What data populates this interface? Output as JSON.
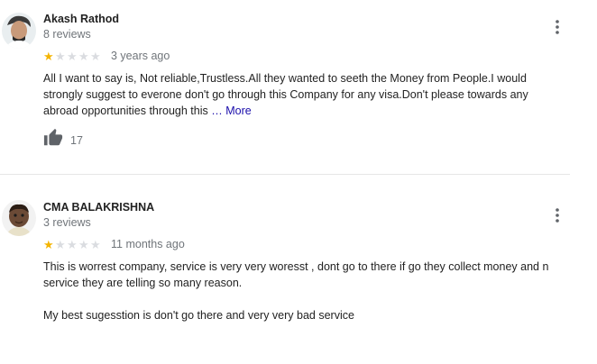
{
  "reviews": [
    {
      "author": "Akash Rathod",
      "review_count": "8 reviews",
      "rating": 1,
      "max_rating": 5,
      "date": "3 years ago",
      "lines": [
        "All I want to say is, Not reliable,Trustless.All they wanted to seeth the Money from People.I would",
        "strongly suggest to everone don't go through this Company for any visa.Don't please towards any",
        "abroad opportunities through this"
      ],
      "ellipsis": "…",
      "more_label": "More",
      "likes": "17",
      "like_icon": "thumbs-up-icon",
      "menu_icon": "more-vert-icon"
    },
    {
      "author": "CMA BALAKRISHNA",
      "review_count": "3 reviews",
      "rating": 1,
      "max_rating": 5,
      "date": "11 months ago",
      "lines": [
        "This is worrest company, service is very very woresst , dont go to there if go they collect money and n",
        "service they are telling so many reason.",
        "",
        "My best sugesstion is don't go there and very very bad service"
      ],
      "menu_icon": "more-vert-icon"
    }
  ],
  "colors": {
    "star_on": "#f4b400",
    "star_off": "#dadce0",
    "link": "#1a0dab",
    "muted": "#70757a"
  }
}
